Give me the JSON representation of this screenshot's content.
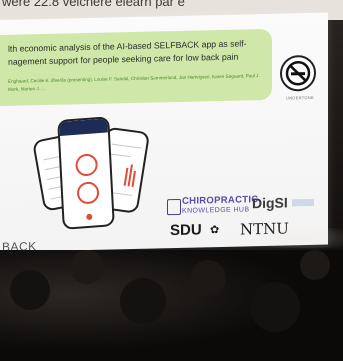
{
  "top_strip_text": "were 22.8 velchere elearn par e",
  "slide": {
    "title_line_1": "lth economic analysis of the AI-based SELFBACK app as self-",
    "title_line_2": "nagement support for people seeking care for low back pain",
    "authors": "Enghaard, Cecilie K. Øverås (presenting), Louise F. Sandal, Christian Sommerlund, Jan Hartvigsen, Karen Søgaard, Paul J. Mork, Morten J. ...",
    "badge_caption": "UNDERTONE",
    "back_label": "BACK",
    "logos": {
      "hub_line_1": "CHIROPRACTIC",
      "hub_line_2": "KNOWLEDGE HUB",
      "digsi": "DigSI",
      "sdu": "SDU",
      "sdu_mark": "✿",
      "ntnu": "NTNU"
    }
  },
  "colors": {
    "title_box": "#cfe7a8",
    "app_bar": "#1d2b57",
    "accent_red": "#e24a3c",
    "hub_purple": "#5b4aa6"
  }
}
